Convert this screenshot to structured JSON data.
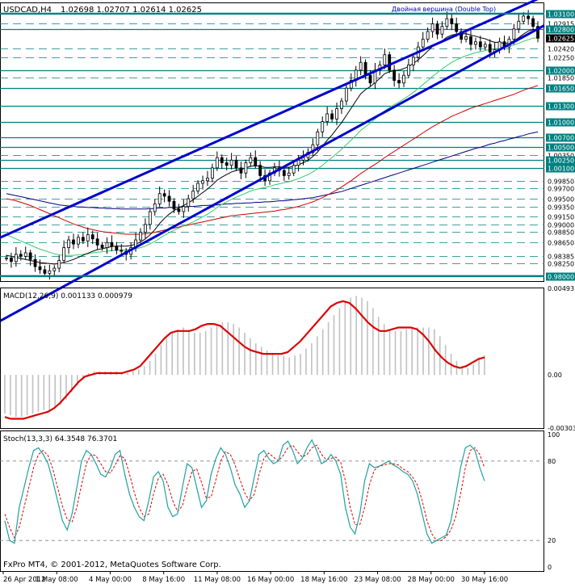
{
  "header": {
    "symbol": "USDCAD,H4",
    "ohlc": "1.02698 1.02707 1.02614 1.02625",
    "annotation": "Двойная вершина (Double Top)"
  },
  "footer": {
    "copyright": "FxPro MT4, © 2001-2012, MetaQuotes Software Corp."
  },
  "colors": {
    "background": "#ffffff",
    "grid": "#008080",
    "candle": "#000000",
    "channel": "#0000cc",
    "ma_fast": "#000000",
    "ma_green": "#33cc66",
    "ma_red": "#cc0000",
    "ma_blue": "#000080",
    "macd_hist": "#c0c0c0",
    "macd_signal": "#dd0000",
    "stoch_main": "#20a0a0",
    "stoch_signal": "#dd0000",
    "axis_highlight": "#008080",
    "current_price_bg": "#000000"
  },
  "chart_data": [
    {
      "type": "line",
      "name": "price",
      "title": "USDCAD,H4",
      "ylim": [
        0.979,
        1.033
      ],
      "price_labels": [
        "1.03100",
        "1.02915",
        "1.02800",
        "1.02420",
        "1.02250",
        "1.02000",
        "1.01850",
        "1.01650",
        "1.01300",
        "1.01000",
        "1.00700",
        "1.00500",
        "1.00350",
        "1.00250",
        "1.00100",
        "0.99850",
        "0.99700",
        "0.99500",
        "0.99350",
        "0.99150",
        "0.99000",
        "0.98850",
        "0.98650",
        "0.98385",
        "0.98250",
        "0.98000"
      ],
      "highlighted_labels": [
        "1.03100",
        "1.02800",
        "1.02000",
        "1.01650",
        "1.01300",
        "1.01000",
        "1.00700",
        "1.00500",
        "1.00250",
        "1.00100",
        "0.98000"
      ],
      "current_price": "1.02625",
      "x_labels": [
        "26 Apr 2012",
        "1 May 08:00",
        "4 May 00:00",
        "8 May 16:00",
        "11 May 08:00",
        "16 May 00:00",
        "18 May 16:00",
        "23 May 08:00",
        "28 May 00:00",
        "30 May 16:00"
      ],
      "close": [
        0.9835,
        0.9828,
        0.9842,
        0.9838,
        0.9845,
        0.9832,
        0.9818,
        0.9812,
        0.9805,
        0.981,
        0.9815,
        0.983,
        0.9855,
        0.987,
        0.9862,
        0.9875,
        0.9868,
        0.988,
        0.9872,
        0.986,
        0.9855,
        0.9865,
        0.9858,
        0.985,
        0.9848,
        0.9842,
        0.9855,
        0.987,
        0.9885,
        0.99,
        0.9925,
        0.994,
        0.996,
        0.9955,
        0.9945,
        0.993,
        0.9925,
        0.9935,
        0.995,
        0.9965,
        0.998,
        0.9985,
        0.999,
        1.001,
        1.003,
        1.002,
        1.0015,
        1.0025,
        1.001,
        1.0,
        1.002,
        1.003,
        1.0015,
        0.9995,
        0.9985,
        1.0,
        1.001,
        1.0005,
        0.9995,
        1.0,
        1.0015,
        1.0025,
        1.003,
        1.004,
        1.0055,
        1.008,
        1.01,
        1.0115,
        1.0105,
        1.0125,
        1.014,
        1.0165,
        1.018,
        1.02,
        1.0215,
        1.019,
        1.0175,
        1.02,
        1.021,
        1.023,
        1.02,
        1.018,
        1.0175,
        1.019,
        1.021,
        1.0225,
        1.0245,
        1.026,
        1.0275,
        1.029,
        1.027,
        1.0285,
        1.03,
        1.029,
        1.0275,
        1.026,
        1.0265,
        1.025,
        1.0255,
        1.0245,
        1.025,
        1.0235,
        1.024,
        1.0255,
        1.0245,
        1.026,
        1.028,
        1.0295,
        1.0305,
        1.03,
        1.0285,
        1.0262
      ],
      "ma_black": [
        0.984,
        0.9838,
        0.9836,
        0.9834,
        0.9832,
        0.983,
        0.9828,
        0.9826,
        0.9825,
        0.9824,
        0.9823,
        0.9824,
        0.9826,
        0.9829,
        0.9832,
        0.9836,
        0.984,
        0.9844,
        0.9848,
        0.9851,
        0.9853,
        0.9855,
        0.9857,
        0.9858,
        0.9858,
        0.9858,
        0.9859,
        0.9862,
        0.9866,
        0.9872,
        0.988,
        0.989,
        0.9902,
        0.9912,
        0.992,
        0.9927,
        0.9932,
        0.9937,
        0.9942,
        0.9948,
        0.9955,
        0.9962,
        0.9969,
        0.9977,
        0.9986,
        0.9992,
        0.9997,
        1.0002,
        1.0005,
        1.0007,
        1.001,
        1.0013,
        1.0014,
        1.0013,
        1.0011,
        1.0011,
        1.0012,
        1.0012,
        1.0011,
        1.0011,
        1.0013,
        1.0016,
        1.002,
        1.0025,
        1.0032,
        1.0041,
        1.0052,
        1.0064,
        1.0074,
        1.0086,
        1.0098,
        1.0112,
        1.0126,
        1.014,
        1.0154,
        1.0162,
        1.0168,
        1.0176,
        1.0184,
        1.0193,
        1.0197,
        1.0199,
        1.02,
        1.0203,
        1.0207,
        1.0213,
        1.022,
        1.0228,
        1.0237,
        1.0246,
        1.0251,
        1.0257,
        1.0264,
        1.0268,
        1.027,
        1.027,
        1.0271,
        1.0268,
        1.0266,
        1.0263,
        1.0261,
        1.0257,
        1.0254,
        1.0254,
        1.0252,
        1.0253,
        1.0257,
        1.0263,
        1.027,
        1.0276,
        1.0279,
        1.0278
      ],
      "ma_green": [
        0.988,
        0.9876,
        0.9872,
        0.9868,
        0.9864,
        0.986,
        0.9856,
        0.9852,
        0.9849,
        0.9846,
        0.9843,
        0.9841,
        0.984,
        0.984,
        0.984,
        0.9841,
        0.9842,
        0.9843,
        0.9845,
        0.9846,
        0.9847,
        0.9848,
        0.9849,
        0.985,
        0.985,
        0.9851,
        0.9852,
        0.9853,
        0.9855,
        0.9858,
        0.9862,
        0.9867,
        0.9873,
        0.9879,
        0.9884,
        0.9889,
        0.9893,
        0.9897,
        0.9901,
        0.9905,
        0.991,
        0.9915,
        0.992,
        0.9926,
        0.9933,
        0.9939,
        0.9944,
        0.9949,
        0.9953,
        0.9957,
        0.9961,
        0.9965,
        0.9968,
        0.997,
        0.9972,
        0.9974,
        0.9977,
        0.9979,
        0.9981,
        0.9983,
        0.9986,
        0.9989,
        0.9993,
        0.9997,
        1.0002,
        1.0008,
        1.0015,
        1.0023,
        1.003,
        1.0038,
        1.0046,
        1.0055,
        1.0064,
        1.0073,
        1.0083,
        1.009,
        1.0097,
        1.0105,
        1.0113,
        1.0121,
        1.0127,
        1.0133,
        1.0138,
        1.0144,
        1.015,
        1.0157,
        1.0164,
        1.0172,
        1.018,
        1.0188,
        1.0195,
        1.0202,
        1.0209,
        1.0215,
        1.022,
        1.0224,
        1.0228,
        1.0231,
        1.0234,
        1.0236,
        1.0238,
        1.024,
        1.0241,
        1.0243,
        1.0244,
        1.0246,
        1.0249,
        1.0252,
        1.0256,
        1.0259,
        1.0262,
        1.0263
      ],
      "ma_red": [
        0.995,
        0.9948,
        0.9946,
        0.9943,
        0.994,
        0.9937,
        0.9933,
        0.9929,
        0.9925,
        0.9921,
        0.9917,
        0.9913,
        0.9909,
        0.9905,
        0.9901,
        0.9898,
        0.9895,
        0.9892,
        0.989,
        0.9888,
        0.9886,
        0.9885,
        0.9884,
        0.9883,
        0.9882,
        0.9881,
        0.9881,
        0.9881,
        0.9881,
        0.9882,
        0.9883,
        0.9885,
        0.9887,
        0.9889,
        0.9891,
        0.9893,
        0.9895,
        0.9897,
        0.9899,
        0.9901,
        0.9903,
        0.9905,
        0.9907,
        0.9909,
        0.9911,
        0.9913,
        0.9915,
        0.9917,
        0.9918,
        0.9919,
        0.992,
        0.9921,
        0.9922,
        0.9923,
        0.9924,
        0.9925,
        0.9926,
        0.9928,
        0.9929,
        0.9931,
        0.9933,
        0.9935,
        0.9938,
        0.9941,
        0.9944,
        0.9948,
        0.9952,
        0.9957,
        0.9962,
        0.9967,
        0.9973,
        0.9979,
        0.9985,
        0.9992,
        0.9999,
        1.0005,
        1.0011,
        1.0017,
        1.0023,
        1.003,
        1.0036,
        1.0042,
        1.0048,
        1.0054,
        1.006,
        1.0066,
        1.0072,
        1.0078,
        1.0084,
        1.009,
        1.0095,
        1.01,
        1.0105,
        1.011,
        1.0114,
        1.0118,
        1.0122,
        1.0126,
        1.0129,
        1.0132,
        1.0135,
        1.0138,
        1.0141,
        1.0144,
        1.0147,
        1.015,
        1.0153,
        1.0157,
        1.0161,
        1.0164,
        1.0167,
        1.017
      ],
      "ma_blue": [
        0.996,
        0.9958,
        0.9956,
        0.9954,
        0.9952,
        0.995,
        0.9948,
        0.9946,
        0.9944,
        0.9942,
        0.994,
        0.9938,
        0.9937,
        0.9936,
        0.9935,
        0.9934,
        0.9934,
        0.9933,
        0.9933,
        0.9932,
        0.9932,
        0.9931,
        0.9931,
        0.9931,
        0.993,
        0.993,
        0.993,
        0.993,
        0.993,
        0.993,
        0.9931,
        0.9931,
        0.9932,
        0.9932,
        0.9933,
        0.9933,
        0.9934,
        0.9934,
        0.9935,
        0.9935,
        0.9936,
        0.9937,
        0.9937,
        0.9938,
        0.9938,
        0.9939,
        0.994,
        0.994,
        0.9941,
        0.9941,
        0.9942,
        0.9942,
        0.9943,
        0.9943,
        0.9944,
        0.9944,
        0.9945,
        0.9946,
        0.9946,
        0.9947,
        0.9948,
        0.9949,
        0.995,
        0.9951,
        0.9952,
        0.9954,
        0.9956,
        0.9958,
        0.996,
        0.9962,
        0.9964,
        0.9967,
        0.997,
        0.9973,
        0.9976,
        0.9979,
        0.9982,
        0.9985,
        0.9988,
        0.9991,
        0.9994,
        0.9997,
        1.0,
        1.0003,
        1.0006,
        1.0009,
        1.0012,
        1.0015,
        1.0018,
        1.0021,
        1.0024,
        1.0027,
        1.003,
        1.0033,
        1.0036,
        1.0039,
        1.0042,
        1.0045,
        1.0048,
        1.005,
        1.0053,
        1.0056,
        1.0058,
        1.0061,
        1.0063,
        1.0066,
        1.0068,
        1.0071,
        1.0073,
        1.0076,
        1.0078,
        1.008
      ],
      "channel_upper": [
        [
          0,
          0.988
        ],
        [
          109,
          1.033
        ]
      ],
      "channel_lower": [
        [
          14,
          0.979
        ],
        [
          109,
          1.027
        ]
      ],
      "grid": true
    },
    {
      "type": "bar",
      "name": "macd",
      "title": "MACD(12,26,9) 0.001133 0.000979",
      "ylim": [
        -0.00303,
        0.00493
      ],
      "y_labels": [
        "0.00493",
        "0.00",
        "-0.00303"
      ],
      "histogram": [
        -0.0022,
        -0.0023,
        -0.0024,
        -0.0024,
        -0.0023,
        -0.0022,
        -0.0021,
        -0.002,
        -0.002,
        -0.0019,
        -0.0017,
        -0.0014,
        -0.001,
        -0.0006,
        -0.0002,
        0.0001,
        0.0002,
        0.0002,
        0.0002,
        0.0002,
        0.0002,
        0.0001,
        0.0001,
        0.0002,
        0.0003,
        0.0005,
        0.0008,
        0.0012,
        0.0017,
        0.0021,
        0.0024,
        0.0026,
        0.0027,
        0.0025,
        0.0024,
        0.0024,
        0.0025,
        0.0027,
        0.0029,
        0.003,
        0.003,
        0.0029,
        0.0027,
        0.0024,
        0.0021,
        0.0018,
        0.0016,
        0.0014,
        0.0012,
        0.0011,
        0.0011,
        0.001,
        0.0011,
        0.0012,
        0.0015,
        0.0018,
        0.0022,
        0.0026,
        0.003,
        0.0034,
        0.0038,
        0.0042,
        0.0044,
        0.0045,
        0.0044,
        0.0042,
        0.0038,
        0.0033,
        0.0029,
        0.0026,
        0.0025,
        0.0025,
        0.0026,
        0.0027,
        0.0027,
        0.0027,
        0.0027,
        0.0026,
        0.0022,
        0.0017,
        0.0012,
        0.0008,
        0.0005,
        0.0004,
        0.0006,
        0.001,
        0.0011
      ],
      "signal": [
        -0.0024,
        -0.0025,
        -0.0025,
        -0.0025,
        -0.0024,
        -0.0023,
        -0.0022,
        -0.0021,
        -0.0019,
        -0.0016,
        -0.0012,
        -0.0008,
        -0.0004,
        -0.0001,
        0.0,
        0.0001,
        0.0001,
        0.0001,
        0.0001,
        0.0001,
        0.0002,
        0.0003,
        0.0005,
        0.0009,
        0.0013,
        0.0017,
        0.0021,
        0.0024,
        0.0025,
        0.0025,
        0.0025,
        0.0026,
        0.0028,
        0.0029,
        0.0029,
        0.0028,
        0.0025,
        0.0022,
        0.0019,
        0.0016,
        0.0014,
        0.0013,
        0.0012,
        0.0012,
        0.0012,
        0.0012,
        0.0013,
        0.0016,
        0.0019,
        0.0023,
        0.0027,
        0.0031,
        0.0035,
        0.0039,
        0.0041,
        0.0042,
        0.0041,
        0.0038,
        0.0034,
        0.003,
        0.0027,
        0.0025,
        0.0025,
        0.0026,
        0.0027,
        0.0027,
        0.0027,
        0.0026,
        0.0023,
        0.0019,
        0.0014,
        0.001,
        0.0007,
        0.0005,
        0.0004,
        0.0005,
        0.0007,
        0.0009,
        0.001
      ],
      "grid": false
    },
    {
      "type": "line",
      "name": "stochastic",
      "title": "Stoch(13,3,3) 64.3548 76.3701",
      "ylim": [
        0,
        100
      ],
      "y_labels": [
        "100",
        "80",
        "20",
        "0"
      ],
      "main": [
        35,
        20,
        18,
        45,
        60,
        75,
        88,
        90,
        85,
        78,
        65,
        50,
        35,
        28,
        40,
        60,
        80,
        88,
        85,
        78,
        70,
        68,
        75,
        85,
        88,
        70,
        55,
        45,
        38,
        35,
        50,
        68,
        72,
        65,
        45,
        38,
        40,
        60,
        78,
        75,
        60,
        45,
        50,
        70,
        82,
        90,
        85,
        75,
        62,
        55,
        45,
        50,
        68,
        85,
        88,
        82,
        78,
        80,
        92,
        95,
        88,
        78,
        82,
        90,
        96,
        88,
        78,
        80,
        85,
        80,
        70,
        45,
        30,
        25,
        40,
        65,
        78,
        75,
        76,
        78,
        80,
        77,
        75,
        72,
        70,
        65,
        55,
        40,
        25,
        18,
        20,
        22,
        24,
        35,
        55,
        75,
        90,
        92,
        88,
        75,
        65
      ],
      "signal": [
        40,
        30,
        22,
        30,
        45,
        60,
        75,
        85,
        88,
        84,
        74,
        60,
        46,
        36,
        34,
        45,
        62,
        78,
        85,
        84,
        78,
        72,
        71,
        77,
        84,
        82,
        70,
        56,
        45,
        38,
        40,
        55,
        67,
        70,
        62,
        50,
        42,
        46,
        60,
        72,
        74,
        64,
        52,
        53,
        66,
        80,
        87,
        85,
        77,
        66,
        56,
        50,
        55,
        70,
        82,
        86,
        83,
        80,
        84,
        90,
        92,
        87,
        83,
        85,
        90,
        92,
        85,
        81,
        82,
        83,
        79,
        65,
        45,
        32,
        32,
        45,
        62,
        73,
        76,
        77,
        78,
        78,
        77,
        74,
        72,
        68,
        62,
        50,
        35,
        25,
        20,
        20,
        23,
        28,
        38,
        55,
        75,
        88,
        90,
        85,
        75
      ],
      "grid": true
    }
  ]
}
